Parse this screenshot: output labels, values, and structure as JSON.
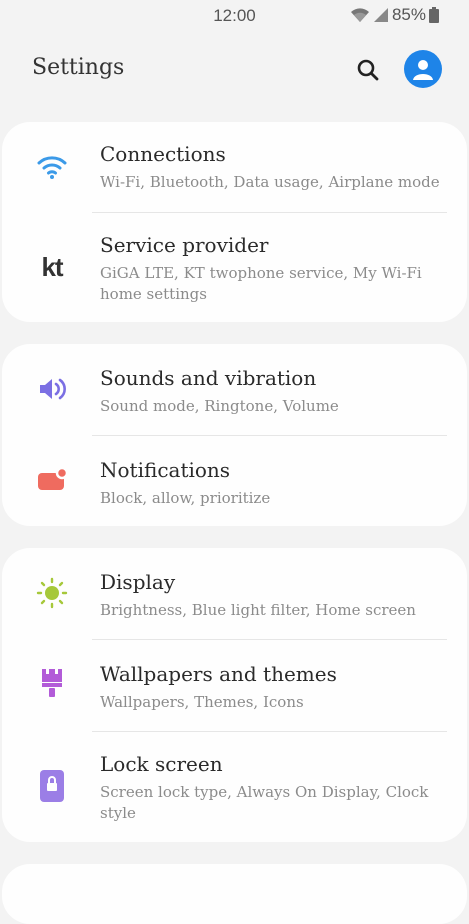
{
  "status_bar": {
    "time": "12:00",
    "battery": "85%"
  },
  "header": {
    "title": "Settings",
    "search_icon": "search-icon",
    "account_icon": "account-icon"
  },
  "groups": [
    {
      "items": [
        {
          "title": "Connections",
          "subtitle": "Wi-Fi, Bluetooth, Data usage, Airplane mode",
          "icon": "wifi-icon",
          "color": "#3b9ae8"
        },
        {
          "title": "Service provider",
          "subtitle": "GiGA LTE, KT twophone service, My Wi-Fi home settings",
          "icon": "kt-logo-icon",
          "logo_text": "kt",
          "color": "#333333"
        }
      ]
    },
    {
      "items": [
        {
          "title": "Sounds and vibration",
          "subtitle": "Sound mode, Ringtone, Volume",
          "icon": "speaker-icon",
          "color": "#7b6fe3"
        },
        {
          "title": "Notifications",
          "subtitle": "Block, allow, prioritize",
          "icon": "notification-icon",
          "color": "#ef6b5f"
        }
      ]
    },
    {
      "items": [
        {
          "title": "Display",
          "subtitle": "Brightness, Blue light filter, Home screen",
          "icon": "sun-icon",
          "color": "#a6c83a"
        },
        {
          "title": "Wallpapers and themes",
          "subtitle": "Wallpapers, Themes, Icons",
          "icon": "paintbrush-icon",
          "color": "#b25bd8"
        },
        {
          "title": "Lock screen",
          "subtitle": "Screen lock type, Always On Display, Clock style",
          "icon": "lock-screen-icon",
          "color": "#9b7ee6"
        }
      ]
    }
  ]
}
